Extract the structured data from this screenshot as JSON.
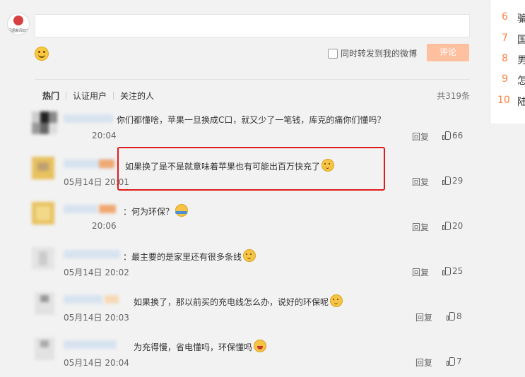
{
  "composer": {
    "self_avatar_text": "凤凰新闻日报",
    "repost_label": "同时转发到我的微博",
    "post_button": "评论"
  },
  "tabs": [
    {
      "label": "热门",
      "active": true
    },
    {
      "label": "认证用户",
      "active": false
    },
    {
      "label": "关注的人",
      "active": false
    }
  ],
  "total_count": "共319条",
  "comments": [
    {
      "text": "你们都懂啥，苹果一旦换成C口，就又少了一笔钱，库克的痛你们懂吗？",
      "time": "20:04",
      "reply": "回复",
      "likes": "66",
      "emoji": ""
    },
    {
      "text": "如果换了是不是就意味着苹果也有可能出百万快充了",
      "time": "05月14日 20:01",
      "reply": "回复",
      "likes": "29",
      "emoji": "cat"
    },
    {
      "text": "：何为环保？",
      "time": "20:06",
      "reply": "回复",
      "likes": "20",
      "emoji": "hug"
    },
    {
      "text": "：最主要的是家里还有很多条线",
      "time": "05月14日 20:02",
      "reply": "回复",
      "likes": "25",
      "emoji": "cat"
    },
    {
      "text": "如果换了，那以前买的充电线怎么办，说好的环保呢",
      "time": "05月14日 20:03",
      "reply": "回复",
      "likes": "8",
      "emoji": "cat"
    },
    {
      "text": "为充得慢，省电懂吗，环保懂吗",
      "time": "05月14日 20:04",
      "reply": "回复",
      "likes": "7",
      "emoji": "laugh"
    }
  ],
  "hot_list": [
    {
      "rank": "6",
      "text": "骗"
    },
    {
      "rank": "7",
      "text": "国"
    },
    {
      "rank": "8",
      "text": "男"
    },
    {
      "rank": "9",
      "text": "怎"
    },
    {
      "rank": "10",
      "text": "陆"
    }
  ]
}
